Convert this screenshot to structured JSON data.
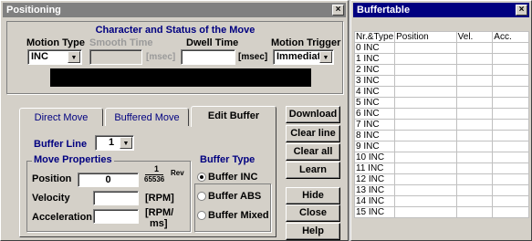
{
  "positioning": {
    "title": "Positioning",
    "close_glyph": "×",
    "header": "Character and Status of the Move",
    "motion_type": {
      "label": "Motion Type",
      "value": "INC"
    },
    "smooth_time": {
      "label": "Smooth Time",
      "value": "",
      "unit": "[msec]"
    },
    "dwell_time": {
      "label": "Dwell Time",
      "value": "",
      "unit": "[msec]"
    },
    "motion_trigger": {
      "label": "Motion Trigger",
      "value": "Immediate"
    },
    "tabs": [
      "Direct Move",
      "Buffered Move",
      "Edit Buffer"
    ],
    "active_tab": "Edit Buffer",
    "buffer_line": {
      "label": "Buffer Line",
      "value": "1"
    },
    "move_properties": {
      "title": "Move Properties",
      "position": {
        "label": "Position",
        "value": "0",
        "unit_num": "1",
        "unit_den": "65536",
        "unit_suffix": "Rev"
      },
      "velocity": {
        "label": "Velocity",
        "value": "",
        "unit": "[RPM]"
      },
      "acceleration": {
        "label": "Acceleration",
        "value": "",
        "unit_line1": "[RPM/",
        "unit_line2": "ms]"
      }
    },
    "buffer_type": {
      "title": "Buffer Type",
      "options": [
        "Buffer INC",
        "Buffer ABS",
        "Buffer Mixed"
      ],
      "selected": "Buffer INC"
    },
    "buttons": {
      "download": "Download",
      "clear_line": "Clear line",
      "clear_all": "Clear all",
      "learn": "Learn",
      "hide_buffer": "Hide Buffer",
      "close": "Close",
      "help": "Help"
    }
  },
  "buffertable": {
    "title": "Buffertable",
    "close_glyph": "×",
    "columns": [
      "Nr.&Type",
      "Position",
      "Vel.",
      "Acc."
    ],
    "rows": [
      "0  INC",
      "1  INC",
      "2  INC",
      "3  INC",
      "4  INC",
      "5  INC",
      "6  INC",
      "7  INC",
      "8  INC",
      "9  INC",
      "10 INC",
      "11 INC",
      "12 INC",
      "13 INC",
      "14 INC",
      "15 INC"
    ]
  },
  "icons": {
    "dropdown": "▼"
  }
}
